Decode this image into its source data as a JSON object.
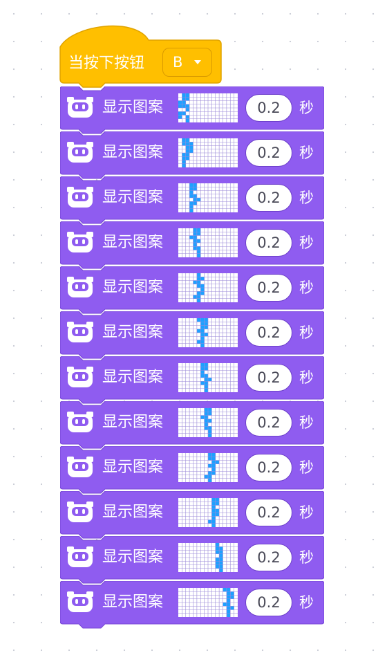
{
  "hat": {
    "label": "当按下按钮",
    "button_value": "B",
    "color": "#ffbf00"
  },
  "block_color": "#8f5cf0",
  "pixel_on_color": "#1ea0ff",
  "pixel_grid_color": "#9b8ad8",
  "pattern_grid": {
    "cols": 16,
    "rows": 8
  },
  "blocks": [
    {
      "label": "显示图案",
      "duration": "0.2",
      "unit": "秒",
      "lit": [
        [
          0,
          1
        ],
        [
          0,
          2
        ],
        [
          1,
          1
        ],
        [
          1,
          2
        ],
        [
          2,
          0
        ],
        [
          2,
          1
        ],
        [
          3,
          0
        ],
        [
          3,
          1
        ],
        [
          3,
          2
        ],
        [
          4,
          2
        ],
        [
          5,
          0
        ],
        [
          5,
          1
        ],
        [
          6,
          0
        ],
        [
          6,
          2
        ],
        [
          7,
          2
        ]
      ]
    },
    {
      "label": "显示图案",
      "duration": "0.2",
      "unit": "秒",
      "lit": [
        [
          0,
          1
        ],
        [
          0,
          2
        ],
        [
          1,
          1
        ],
        [
          1,
          2
        ],
        [
          1,
          3
        ],
        [
          2,
          2
        ],
        [
          2,
          3
        ],
        [
          3,
          2
        ],
        [
          3,
          3
        ],
        [
          4,
          1
        ],
        [
          4,
          2
        ],
        [
          5,
          1
        ],
        [
          5,
          2
        ],
        [
          6,
          1
        ],
        [
          7,
          1
        ]
      ]
    },
    {
      "label": "显示图案",
      "duration": "0.2",
      "unit": "秒",
      "lit": [
        [
          0,
          3
        ],
        [
          0,
          4
        ],
        [
          1,
          3
        ],
        [
          1,
          4
        ],
        [
          2,
          3
        ],
        [
          3,
          3
        ],
        [
          3,
          4
        ],
        [
          4,
          4
        ],
        [
          4,
          5
        ],
        [
          5,
          3
        ],
        [
          5,
          4
        ],
        [
          6,
          3
        ],
        [
          7,
          3
        ]
      ]
    },
    {
      "label": "显示图案",
      "duration": "0.2",
      "unit": "秒",
      "lit": [
        [
          0,
          4
        ],
        [
          0,
          5
        ],
        [
          1,
          4
        ],
        [
          1,
          5
        ],
        [
          2,
          3
        ],
        [
          2,
          4
        ],
        [
          3,
          4
        ],
        [
          3,
          5
        ],
        [
          4,
          4
        ],
        [
          5,
          4
        ],
        [
          5,
          5
        ],
        [
          6,
          5
        ],
        [
          7,
          5
        ]
      ]
    },
    {
      "label": "显示图案",
      "duration": "0.2",
      "unit": "秒",
      "lit": [
        [
          0,
          5
        ],
        [
          1,
          5
        ],
        [
          1,
          6
        ],
        [
          2,
          4
        ],
        [
          2,
          5
        ],
        [
          3,
          5
        ],
        [
          3,
          6
        ],
        [
          4,
          6
        ],
        [
          5,
          5
        ],
        [
          5,
          6
        ],
        [
          6,
          4
        ],
        [
          6,
          5
        ],
        [
          7,
          5
        ]
      ]
    },
    {
      "label": "显示图案",
      "duration": "0.2",
      "unit": "秒",
      "lit": [
        [
          0,
          5
        ],
        [
          0,
          6
        ],
        [
          0,
          7
        ],
        [
          1,
          6
        ],
        [
          1,
          7
        ],
        [
          2,
          6
        ],
        [
          2,
          7
        ],
        [
          3,
          5
        ],
        [
          3,
          6
        ],
        [
          4,
          6
        ],
        [
          4,
          7
        ],
        [
          5,
          6
        ],
        [
          6,
          5
        ],
        [
          6,
          6
        ],
        [
          7,
          6
        ]
      ]
    },
    {
      "label": "显示图案",
      "duration": "0.2",
      "unit": "秒",
      "lit": [
        [
          0,
          6
        ],
        [
          0,
          7
        ],
        [
          1,
          6
        ],
        [
          1,
          7
        ],
        [
          2,
          6
        ],
        [
          3,
          6
        ],
        [
          3,
          7
        ],
        [
          4,
          7
        ],
        [
          4,
          8
        ],
        [
          5,
          6
        ],
        [
          5,
          7
        ],
        [
          6,
          7
        ],
        [
          7,
          7
        ]
      ]
    },
    {
      "label": "显示图案",
      "duration": "0.2",
      "unit": "秒",
      "lit": [
        [
          0,
          7
        ],
        [
          0,
          8
        ],
        [
          1,
          7
        ],
        [
          1,
          8
        ],
        [
          2,
          6
        ],
        [
          2,
          7
        ],
        [
          3,
          7
        ],
        [
          3,
          8
        ],
        [
          4,
          7
        ],
        [
          5,
          7
        ],
        [
          5,
          8
        ],
        [
          6,
          8
        ],
        [
          7,
          8
        ]
      ]
    },
    {
      "label": "显示图案",
      "duration": "0.2",
      "unit": "秒",
      "lit": [
        [
          0,
          8
        ],
        [
          0,
          9
        ],
        [
          1,
          8
        ],
        [
          1,
          9
        ],
        [
          2,
          9
        ],
        [
          2,
          10
        ],
        [
          3,
          8
        ],
        [
          3,
          9
        ],
        [
          4,
          9
        ],
        [
          5,
          8
        ],
        [
          5,
          9
        ],
        [
          6,
          7
        ],
        [
          6,
          8
        ],
        [
          7,
          8
        ]
      ]
    },
    {
      "label": "显示图案",
      "duration": "0.2",
      "unit": "秒",
      "lit": [
        [
          0,
          9
        ],
        [
          0,
          10
        ],
        [
          1,
          9
        ],
        [
          1,
          10
        ],
        [
          2,
          9
        ],
        [
          3,
          9
        ],
        [
          3,
          10
        ],
        [
          4,
          9
        ],
        [
          4,
          10
        ],
        [
          5,
          9
        ],
        [
          6,
          8
        ],
        [
          6,
          9
        ],
        [
          7,
          9
        ]
      ]
    },
    {
      "label": "显示图案",
      "duration": "0.2",
      "unit": "秒",
      "lit": [
        [
          0,
          10
        ],
        [
          1,
          10
        ],
        [
          1,
          11
        ],
        [
          2,
          10
        ],
        [
          2,
          11
        ],
        [
          3,
          11
        ],
        [
          4,
          10
        ],
        [
          4,
          11
        ],
        [
          5,
          10
        ],
        [
          5,
          11
        ],
        [
          6,
          10
        ],
        [
          6,
          11
        ],
        [
          7,
          11
        ]
      ]
    },
    {
      "label": "显示图案",
      "duration": "0.2",
      "unit": "秒",
      "lit": [
        [
          0,
          12
        ],
        [
          0,
          13
        ],
        [
          1,
          13
        ],
        [
          1,
          14
        ],
        [
          2,
          13
        ],
        [
          2,
          14
        ],
        [
          3,
          13
        ],
        [
          4,
          12
        ],
        [
          4,
          13
        ],
        [
          5,
          13
        ],
        [
          5,
          14
        ],
        [
          6,
          13
        ],
        [
          7,
          13
        ]
      ]
    }
  ]
}
